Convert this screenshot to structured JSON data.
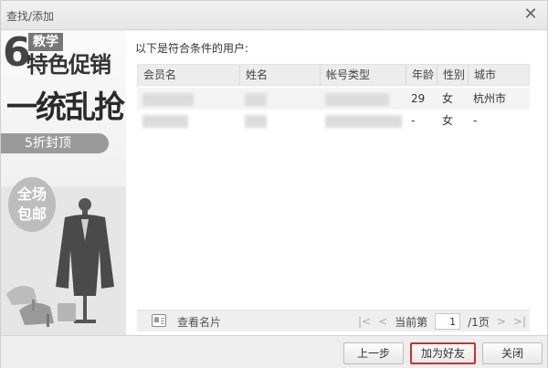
{
  "window": {
    "title": "查找/添加",
    "close_glyph": "✕"
  },
  "banner": {
    "number": "6",
    "tag": "教学",
    "line1": "特色促销",
    "line2": "一统乱抢",
    "strip_text": "5折封顶",
    "circle_line1": "全场",
    "circle_line2": "包邮"
  },
  "results": {
    "label": "以下是符合条件的用户:",
    "columns": [
      "会员名",
      "姓名",
      "帐号类型",
      "年龄",
      "性别",
      "城市"
    ],
    "rows": [
      {
        "age": "29",
        "gender": "女",
        "city": "杭州市"
      },
      {
        "age": "-",
        "gender": "女",
        "city": "-"
      }
    ]
  },
  "bottom_bar": {
    "view_card": "查看名片",
    "page_prefix": "当前第",
    "page_value": "1",
    "page_suffix": "/1页",
    "first_glyph": "|<",
    "prev_glyph": "<",
    "next_glyph": ">",
    "last_glyph": ">|"
  },
  "footer": {
    "prev_label": "上一步",
    "add_friend_label": "加为好友",
    "close_label": "关闭"
  },
  "colors": {
    "highlight_border": "#d2302a"
  }
}
